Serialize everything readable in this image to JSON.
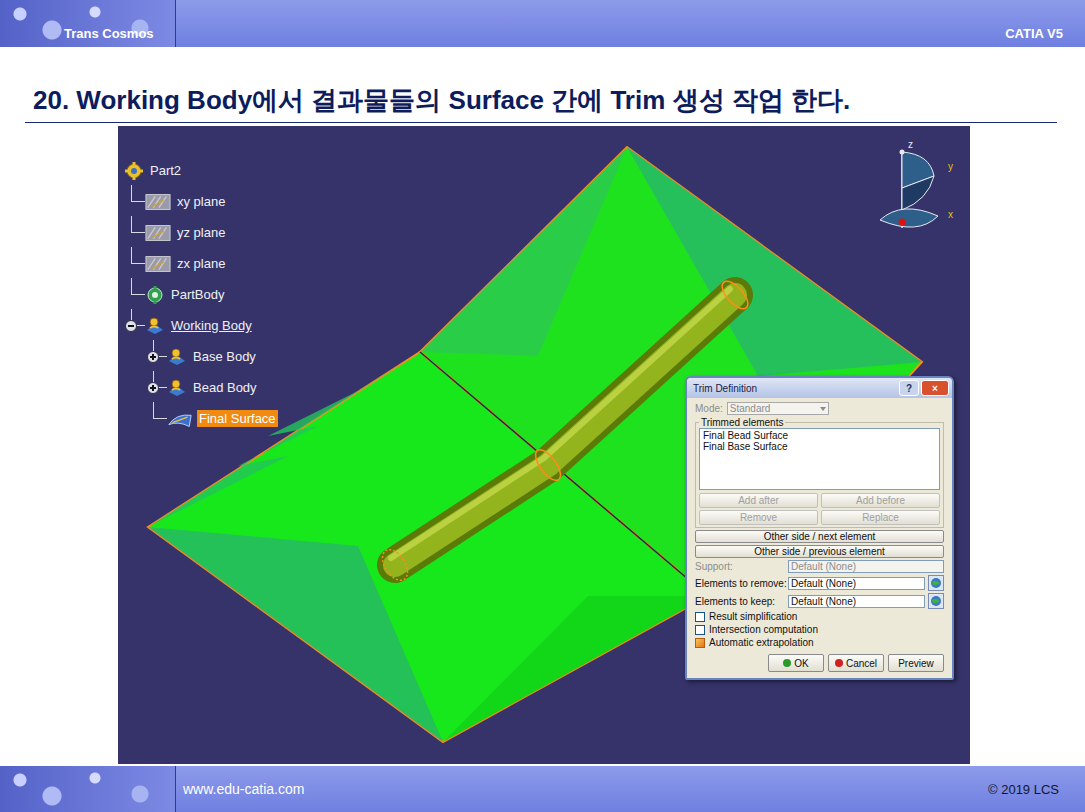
{
  "header": {
    "brand": "Trans Cosmos",
    "product": "CATIA V5"
  },
  "title": "20. Working Body에서 결과물들의 Surface 간에 Trim 생성 작업 한다.",
  "tree": {
    "items": [
      {
        "label": "Part2",
        "depth": 0,
        "kind": "part",
        "has_toggle": false,
        "expanded": true,
        "current": false,
        "selected": false
      },
      {
        "label": "xy plane",
        "depth": 1,
        "kind": "plane",
        "has_toggle": false,
        "expanded": false,
        "current": false,
        "selected": false
      },
      {
        "label": "yz plane",
        "depth": 1,
        "kind": "plane",
        "has_toggle": false,
        "expanded": false,
        "current": false,
        "selected": false
      },
      {
        "label": "zx plane",
        "depth": 1,
        "kind": "plane",
        "has_toggle": false,
        "expanded": false,
        "current": false,
        "selected": false
      },
      {
        "label": "PartBody",
        "depth": 1,
        "kind": "body",
        "has_toggle": false,
        "expanded": false,
        "current": false,
        "selected": false
      },
      {
        "label": "Working Body",
        "depth": 1,
        "kind": "geoset",
        "has_toggle": true,
        "expanded": true,
        "current": true,
        "selected": false
      },
      {
        "label": "Base Body",
        "depth": 2,
        "kind": "geoset",
        "has_toggle": true,
        "expanded": false,
        "current": false,
        "selected": false
      },
      {
        "label": "Bead Body",
        "depth": 2,
        "kind": "geoset",
        "has_toggle": true,
        "expanded": false,
        "current": false,
        "selected": false
      },
      {
        "label": "Final Surface",
        "depth": 2,
        "kind": "surface",
        "has_toggle": false,
        "expanded": false,
        "current": false,
        "selected": true
      }
    ]
  },
  "compass": {
    "axes": [
      "z",
      "y",
      "x"
    ]
  },
  "dialog": {
    "title": "Trim Definition",
    "help": "?",
    "close": "×",
    "mode": {
      "label": "Mode:",
      "value": "Standard",
      "disabled": true
    },
    "group_label": "Trimmed elements",
    "elements": [
      "Final Bead Surface",
      "Final Base Surface"
    ],
    "list_buttons": [
      {
        "label": "Add after",
        "disabled": true
      },
      {
        "label": "Add before",
        "disabled": true
      },
      {
        "label": "Remove",
        "disabled": true
      },
      {
        "label": "Replace",
        "disabled": true
      }
    ],
    "side_buttons": [
      "Other side / next element",
      "Other side / previous element"
    ],
    "fields": [
      {
        "label": "Support:",
        "value": "Default (None)",
        "disabled": true,
        "picker": false
      },
      {
        "label": "Elements to remove:",
        "value": "Default (None)",
        "disabled": false,
        "picker": true
      },
      {
        "label": "Elements to keep:",
        "value": "Default (None)",
        "disabled": false,
        "picker": true
      }
    ],
    "checks": [
      {
        "label": "Result simplification",
        "checked": false
      },
      {
        "label": "Intersection computation",
        "checked": false
      },
      {
        "label": "Automatic extrapolation",
        "checked": true
      }
    ],
    "buttons": [
      {
        "label": "OK",
        "kind": "ok"
      },
      {
        "label": "Cancel",
        "kind": "cancel"
      },
      {
        "label": "Preview",
        "kind": "plain"
      }
    ]
  },
  "footer": {
    "url": "www.edu-catia.com",
    "copyright": "© 2019 LCS"
  }
}
